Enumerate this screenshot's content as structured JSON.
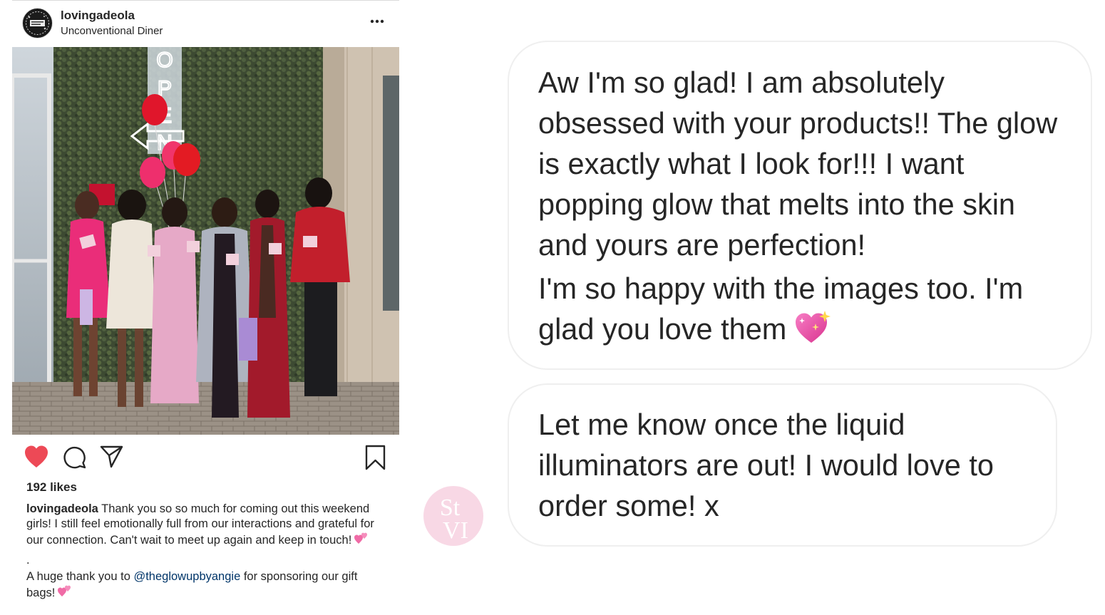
{
  "post": {
    "username": "lovingadeola",
    "location": "Unconventional Diner",
    "likes": "192 likes",
    "caption_user": "lovingadeola",
    "caption_text": "Thank you so so much for coming out this weekend girls! I still feel emotionally full from our interactions and grateful for our connection. Can't wait to meet up again and keep in touch!",
    "caption_dot": ".",
    "thanks_prefix": "A huge thank you to",
    "mention": "@theglowupbyangie",
    "thanks_suffix": "for sponsoring our gift bags!",
    "icons": {
      "like": "heart-filled-icon",
      "comment": "comment-icon",
      "share": "send-icon",
      "save": "bookmark-icon",
      "more": "ellipsis-icon"
    },
    "colors": {
      "like_red": "#ed4956",
      "mention_blue": "#003569"
    }
  },
  "messages": {
    "bubble1_text1": "Aw I'm so glad! I am absolutely obsessed with your products!! The glow is exactly what I look for!!! I want popping glow that melts into the skin and yours are perfection!",
    "bubble1_text2": "I'm so happy with the images too. I'm glad you love them",
    "bubble2_text1": "Let me know once the liquid illuminators are out! I would love to order some! x",
    "emoji": "sparkling-heart"
  },
  "watermark": {
    "line1": "St",
    "line2": "VI",
    "color": "#f2b8cf"
  }
}
